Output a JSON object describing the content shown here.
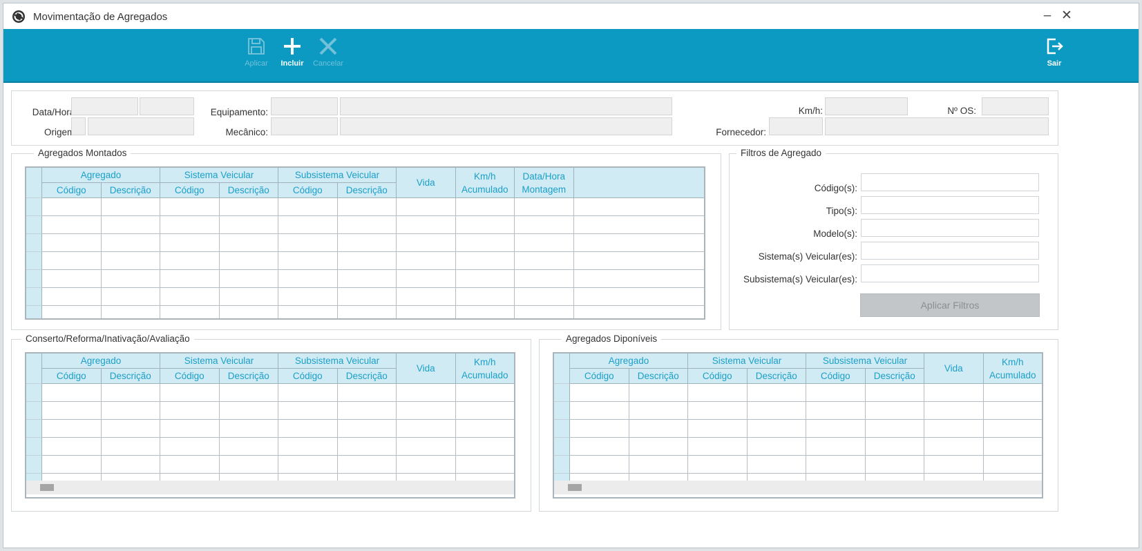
{
  "window": {
    "title": "Movimentação de Agregados",
    "minimize": "–",
    "close": "✕"
  },
  "toolbar": {
    "apply": {
      "label": "Aplicar",
      "icon": "save-icon"
    },
    "add": {
      "label": "Incluir",
      "icon": "plus-icon"
    },
    "cancel": {
      "label": "Cancelar",
      "icon": "close-icon"
    },
    "exit": {
      "label": "Sair",
      "icon": "exit-icon"
    }
  },
  "header_form": {
    "datetime_label": "Data/Hora:",
    "origin_label": "Origem:",
    "equipment_label": "Equipamento:",
    "mechanic_label": "Mecânico:",
    "km_label": "Km/h:",
    "os_label": "Nº OS:",
    "supplier_label": "Fornecedor:"
  },
  "mounted": {
    "title": "Agregados Montados",
    "group_headers": [
      "Agregado",
      "Sistema Veicular",
      "Subsistema Veicular"
    ],
    "sub_headers": [
      "Código",
      "Descrição",
      "Código",
      "Descrição",
      "Código",
      "Descrição"
    ],
    "vida": "Vida",
    "km_line1": "Km/h",
    "km_line2": "Acumulado",
    "date_line1": "Data/Hora",
    "date_line2": "Montagem"
  },
  "filters": {
    "title": "Filtros de Agregado",
    "codes_label": "Código(s):",
    "types_label": "Tipo(s):",
    "models_label": "Modelo(s):",
    "systems_label": "Sistema(s) Veicular(es):",
    "subsystems_label": "Subsistema(s) Veicular(es):",
    "apply_button": "Aplicar Filtros"
  },
  "repair": {
    "title": "Conserto/Reforma/Inativação/Avaliação",
    "group_headers": [
      "Agregado",
      "Sistema Veicular",
      "Subsistema Veicular"
    ],
    "sub_headers": [
      "Código",
      "Descrição",
      "Código",
      "Descrição",
      "Código",
      "Descrição"
    ],
    "vida": "Vida",
    "km_line1": "Km/h",
    "km_line2": "Acumulado"
  },
  "available": {
    "title": "Agregados Diponíveis",
    "group_headers": [
      "Agregado",
      "Sistema Veicular",
      "Subsistema Veicular"
    ],
    "sub_headers": [
      "Código",
      "Descrição",
      "Código",
      "Descrição",
      "Código",
      "Descrição"
    ],
    "vida": "Vida",
    "km_line1": "Km/h",
    "km_line2": "Acumulado"
  },
  "colors": {
    "toolbar": "#0c9ac3",
    "header_bg": "#d1ebf4",
    "header_text": "#1a9fc8"
  }
}
